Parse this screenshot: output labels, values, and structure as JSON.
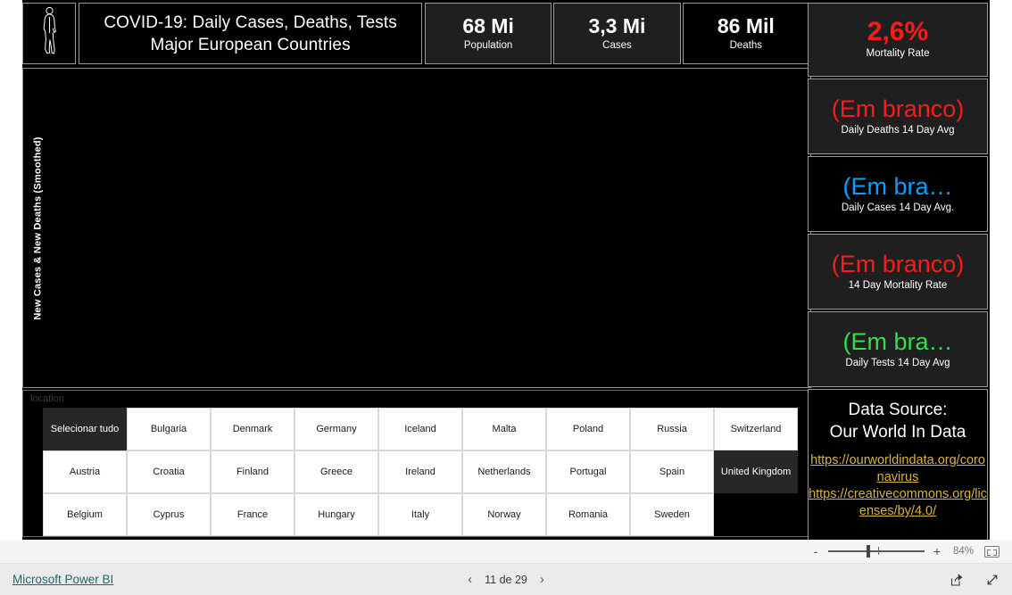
{
  "report": {
    "icon": "walking-person-icon",
    "title_line1": "COVID-19: Daily Cases, Deaths, Tests",
    "title_line2": "Major European Countries",
    "kpis": [
      {
        "value": "68 Mi",
        "label": "Population",
        "background": "#1f1f1f"
      },
      {
        "value": "3,3 Mi",
        "label": "Cases",
        "background": "#1f1f1f"
      },
      {
        "value": "86 Mil",
        "label": "Deaths",
        "background": "#000000"
      }
    ]
  },
  "chart_data": {
    "type": "line",
    "title": "COVID-19: Daily Cases, Deaths, Tests",
    "ylabel": "New Cases & New Deaths (Smoothed)",
    "xlabel": "",
    "series": [],
    "categories": [],
    "values": [],
    "grid": false,
    "legend": "none",
    "note": "Plot area is blank — no data rendered for current selection",
    "background": "#000000"
  },
  "slicer": {
    "header": "location",
    "items": [
      {
        "label": "Selecionar tudo",
        "selected": true
      },
      {
        "label": "Bulgaria",
        "selected": false
      },
      {
        "label": "Denmark",
        "selected": false
      },
      {
        "label": "Germany",
        "selected": false
      },
      {
        "label": "Iceland",
        "selected": false
      },
      {
        "label": "Malta",
        "selected": false
      },
      {
        "label": "Poland",
        "selected": false
      },
      {
        "label": "Russia",
        "selected": false
      },
      {
        "label": "Switzerland",
        "selected": false
      },
      {
        "label": "Austria",
        "selected": false
      },
      {
        "label": "Croatia",
        "selected": false
      },
      {
        "label": "Finland",
        "selected": false
      },
      {
        "label": "Greece",
        "selected": false
      },
      {
        "label": "Ireland",
        "selected": false
      },
      {
        "label": "Netherlands",
        "selected": false
      },
      {
        "label": "Portugal",
        "selected": false
      },
      {
        "label": "Spain",
        "selected": false
      },
      {
        "label": "United Kingdom",
        "selected": true
      },
      {
        "label": "Belgium",
        "selected": false
      },
      {
        "label": "Cyprus",
        "selected": false
      },
      {
        "label": "France",
        "selected": false
      },
      {
        "label": "Hungary",
        "selected": false
      },
      {
        "label": "Italy",
        "selected": false
      },
      {
        "label": "Norway",
        "selected": false
      },
      {
        "label": "Romania",
        "selected": false
      },
      {
        "label": "Sweden",
        "selected": false
      },
      {
        "label": "",
        "selected": false,
        "empty": true
      }
    ]
  },
  "sidebar": {
    "cards": [
      {
        "value": "2,6%",
        "label": "Mortality Rate",
        "color": "#ff1a1a",
        "background": "#1f1f1f"
      },
      {
        "value": "(Em branco)",
        "label": "Daily Deaths 14 Day Avg",
        "color": "#ff1a1a",
        "background": "#1f1f1f"
      },
      {
        "value": "(Em bra…",
        "label": "Daily Cases 14 Day Avg.",
        "color": "#00a2ff",
        "background": "#000000"
      },
      {
        "value": "(Em branco)",
        "label": "14 Day Mortality Rate",
        "color": "#ff1a1a",
        "background": "#1f1f1f"
      },
      {
        "value": "(Em bra…",
        "label": "Daily Tests 14 Day Avg",
        "color": "#2fe04a",
        "background": "#1f1f1f"
      }
    ],
    "source": {
      "title_line1": "Data Source:",
      "title_line2": "Our World In Data",
      "links": [
        "https://ourworldindata.org/coronavirus",
        "https://creativecommons.org/licenses/by/4.0/"
      ],
      "link_color": "#d9b43c"
    }
  },
  "zoombar": {
    "minus": "-",
    "plus": "+",
    "percent": "84%",
    "fit_icon": "fit-to-page-icon"
  },
  "statusbar": {
    "brand": "Microsoft Power BI",
    "prev_icon": "chevron-left-icon",
    "page_label": "11 de 29",
    "next_icon": "chevron-right-icon",
    "share_icon": "share-icon",
    "fullscreen_icon": "fullscreen-icon"
  }
}
